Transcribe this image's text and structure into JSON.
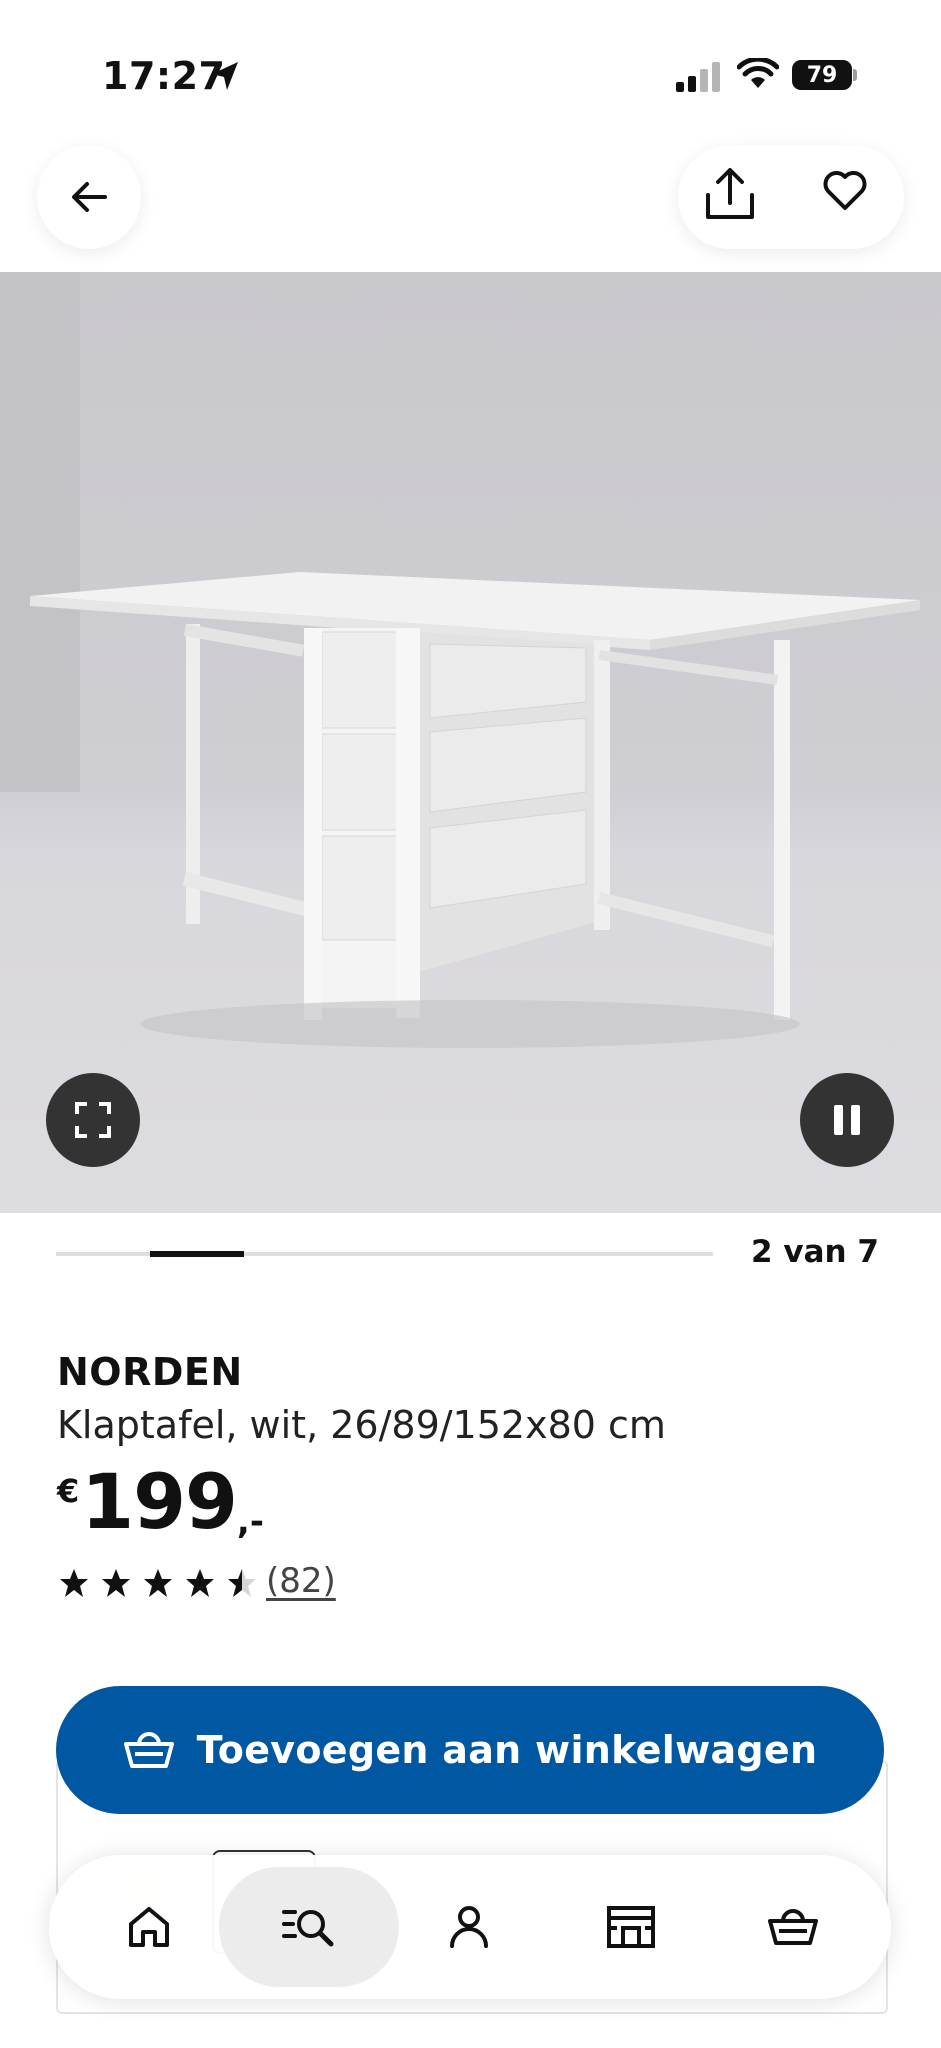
{
  "status_bar": {
    "time": "17:27",
    "battery": "79"
  },
  "gallery": {
    "counter": "2 van 7",
    "current_index": 2,
    "total": 7
  },
  "product": {
    "name": "NORDEN",
    "description": "Klaptafel, wit, 26/89/152x80 cm",
    "price_currency": "€",
    "price_integer": "199",
    "price_decimal": ",-",
    "rating": 4.5,
    "review_count": "(82)"
  },
  "cta": {
    "label": "Toevoegen aan winkelwagen"
  },
  "bottom_nav": {
    "items": [
      {
        "icon": "home-icon"
      },
      {
        "icon": "search-list-icon",
        "active": true
      },
      {
        "icon": "profile-icon"
      },
      {
        "icon": "store-icon"
      },
      {
        "icon": "cart-icon"
      }
    ]
  },
  "colors": {
    "brand_blue": "#0058a3",
    "overlay_button": "#333333"
  }
}
